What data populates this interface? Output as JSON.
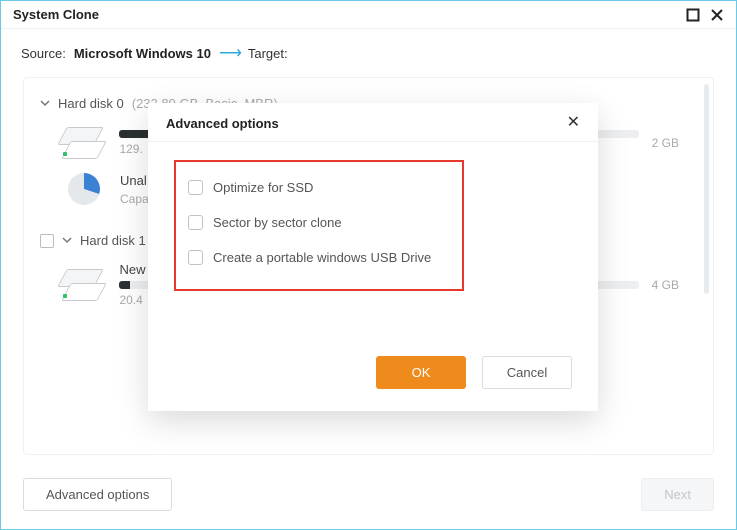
{
  "window": {
    "title": "System Clone"
  },
  "source": {
    "label": "Source:",
    "value": "Microsoft Windows 10"
  },
  "target": {
    "label": "Target:",
    "value": ""
  },
  "disks": [
    {
      "title": "Hard disk 0",
      "meta": "(232.89 GB, Basic, MBR)",
      "expanded": true,
      "selectable": false,
      "volumes": [
        {
          "icon": "drive",
          "bar_title": "",
          "sub_left": "129.",
          "right": "2 GB",
          "used_pct": 8
        },
        {
          "icon": "pie",
          "name": "Unal",
          "sub_left": "Capa",
          "right": "",
          "used_pct": 0
        }
      ]
    },
    {
      "title": "Hard disk 1",
      "meta": "(",
      "expanded": true,
      "selectable": true,
      "volumes": [
        {
          "icon": "drive",
          "name": "New",
          "sub_left": "20.4",
          "right": "4 GB",
          "used_pct": 2
        }
      ]
    }
  ],
  "footer": {
    "advanced": "Advanced options",
    "next": "Next"
  },
  "modal": {
    "title": "Advanced options",
    "options": [
      "Optimize for SSD",
      "Sector by sector clone",
      "Create a portable windows USB Drive"
    ],
    "ok": "OK",
    "cancel": "Cancel"
  }
}
